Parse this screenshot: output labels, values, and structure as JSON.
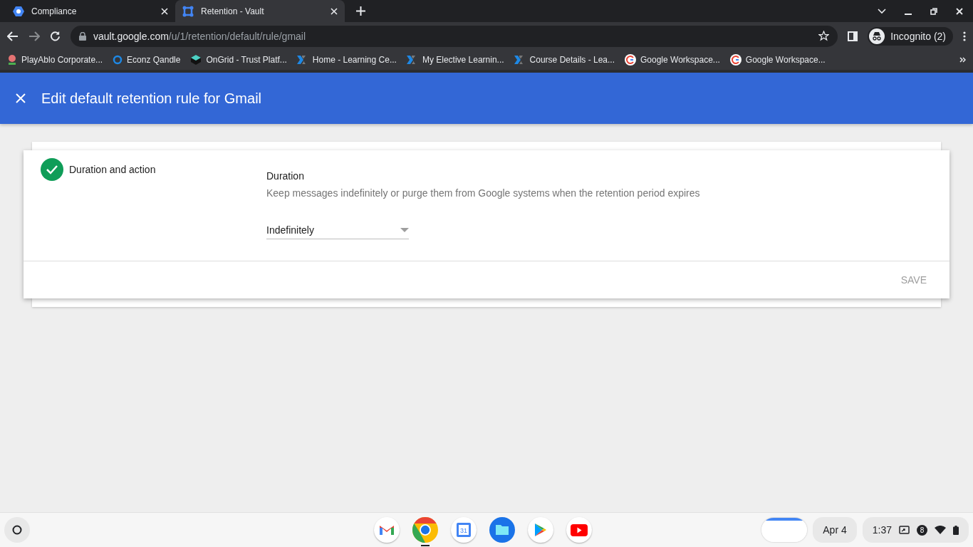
{
  "browser": {
    "tabs": [
      {
        "title": "Compliance",
        "selected": false,
        "kind": "hex"
      },
      {
        "title": "Retention - Vault",
        "selected": true,
        "kind": "vault"
      }
    ],
    "url": {
      "host": "vault.google.com",
      "path": "/u/1/retention/default/rule/gmail"
    },
    "profile": "Incognito (2)",
    "bookmarks": [
      {
        "label": "PlayAblo Corporate...",
        "kind": "pin"
      },
      {
        "label": "Econz Qandle",
        "kind": "ring"
      },
      {
        "label": "OnGrid - Trust Platf...",
        "kind": "cube"
      },
      {
        "label": "Home - Learning Ce...",
        "kind": "x"
      },
      {
        "label": "My Elective Learnin...",
        "kind": "x"
      },
      {
        "label": "Course Details - Lea...",
        "kind": "x"
      },
      {
        "label": "Google Workspace...",
        "kind": "g"
      },
      {
        "label": "Google Workspace...",
        "kind": "g"
      }
    ]
  },
  "header": {
    "title": "Edit default retention rule for Gmail"
  },
  "step": {
    "label": "Duration and action",
    "completed": true
  },
  "duration": {
    "title": "Duration",
    "description": "Keep messages indefinitely or purge them from Google systems when the retention period expires",
    "value": "Indefinitely"
  },
  "save_button": {
    "label": "SAVE",
    "disabled": true
  },
  "shelf": {
    "apps": [
      {
        "kind": "gmail",
        "active": false
      },
      {
        "kind": "chrome",
        "active": true
      },
      {
        "kind": "calendar",
        "active": false,
        "text": "31"
      },
      {
        "kind": "files",
        "active": false
      },
      {
        "kind": "play",
        "active": false
      },
      {
        "kind": "youtube",
        "active": false
      }
    ],
    "date": "Apr 4",
    "time": "1:37",
    "notifications": "8"
  }
}
